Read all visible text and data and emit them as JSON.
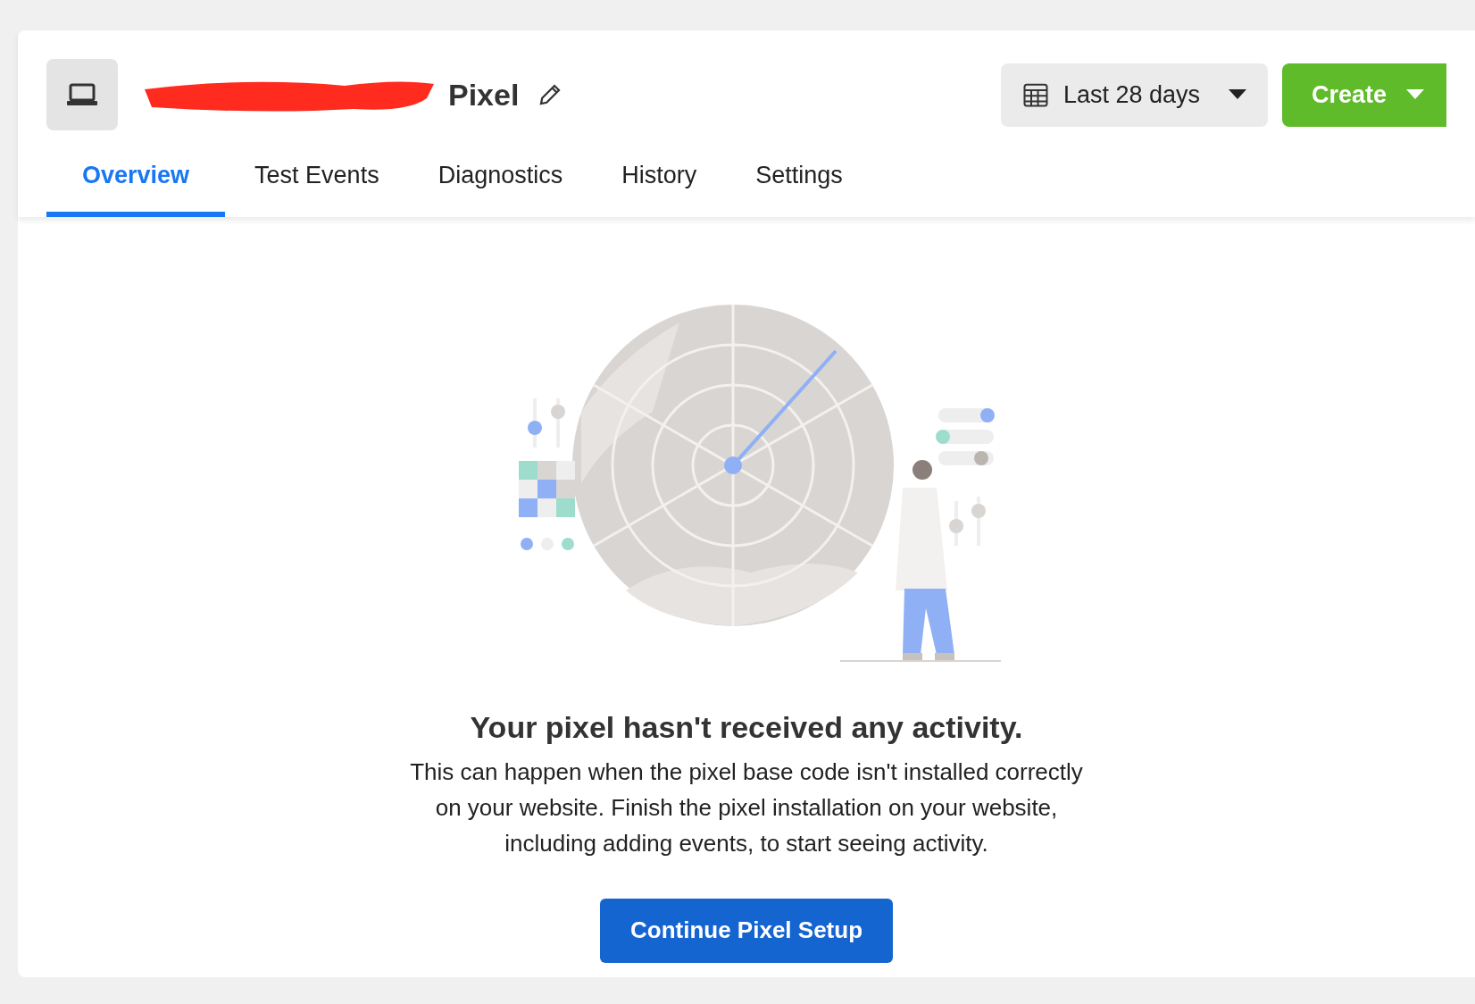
{
  "header": {
    "title": "Pixel",
    "date_range": "Last 28 days",
    "create_button": "Create"
  },
  "tabs": [
    {
      "label": "Overview",
      "selected": true
    },
    {
      "label": "Test Events",
      "selected": false
    },
    {
      "label": "Diagnostics",
      "selected": false
    },
    {
      "label": "History",
      "selected": false
    },
    {
      "label": "Settings",
      "selected": false
    }
  ],
  "empty_state": {
    "heading": "Your pixel hasn't received any activity.",
    "body": "This can happen when the pixel base code isn't installed correctly on your website. Finish the pixel installation on your website, including adding events, to start seeing activity.",
    "button": "Continue Pixel Setup"
  }
}
